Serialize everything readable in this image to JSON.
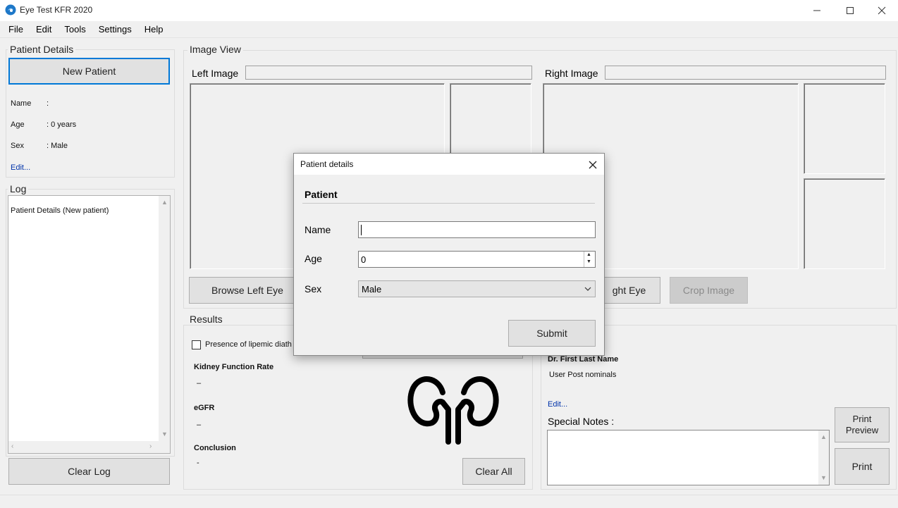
{
  "window": {
    "title": "Eye Test KFR 2020"
  },
  "menu": [
    "File",
    "Edit",
    "Tools",
    "Settings",
    "Help"
  ],
  "patient_details": {
    "group_title": "Patient Details",
    "new_patient_label": "New Patient",
    "name_label": "Name",
    "name_value": ":",
    "age_label": "Age",
    "age_value": ": 0 years",
    "sex_label": "Sex",
    "sex_value": ": Male",
    "edit_link": "Edit..."
  },
  "log": {
    "group_title": "Log",
    "entries": [
      "Patient Details (New patient)"
    ],
    "clear_label": "Clear Log"
  },
  "image_view": {
    "group_title": "Image View",
    "left_label": "Left Image",
    "right_label": "Right Image",
    "browse_left_label": "Browse Left Eye",
    "browse_right_label": "ght Eye",
    "crop_label": "Crop Image"
  },
  "results": {
    "group_title": "Results",
    "lipemic_label": "Presence of lipemic diath",
    "kidney_rate_label": "Kidney Function Rate",
    "kidney_rate_value": "–",
    "egfr_label": "eGFR",
    "egfr_value": "–",
    "conclusion_label": "Conclusion",
    "conclusion_value": "-",
    "clear_all_label": "Clear All"
  },
  "doctor": {
    "name": "Dr. First Last Name",
    "post_nominals": "User Post nominals",
    "edit_link": "Edit...",
    "special_notes_label": "Special Notes :",
    "print_preview_label": "Print Preview",
    "print_label": "Print"
  },
  "dialog": {
    "title": "Patient details",
    "section": "Patient",
    "name_label": "Name",
    "name_value": "",
    "age_label": "Age",
    "age_value": "0",
    "sex_label": "Sex",
    "sex_value": "Male",
    "submit_label": "Submit"
  },
  "colors": {
    "accent": "#0078d7",
    "link": "#0033aa"
  }
}
